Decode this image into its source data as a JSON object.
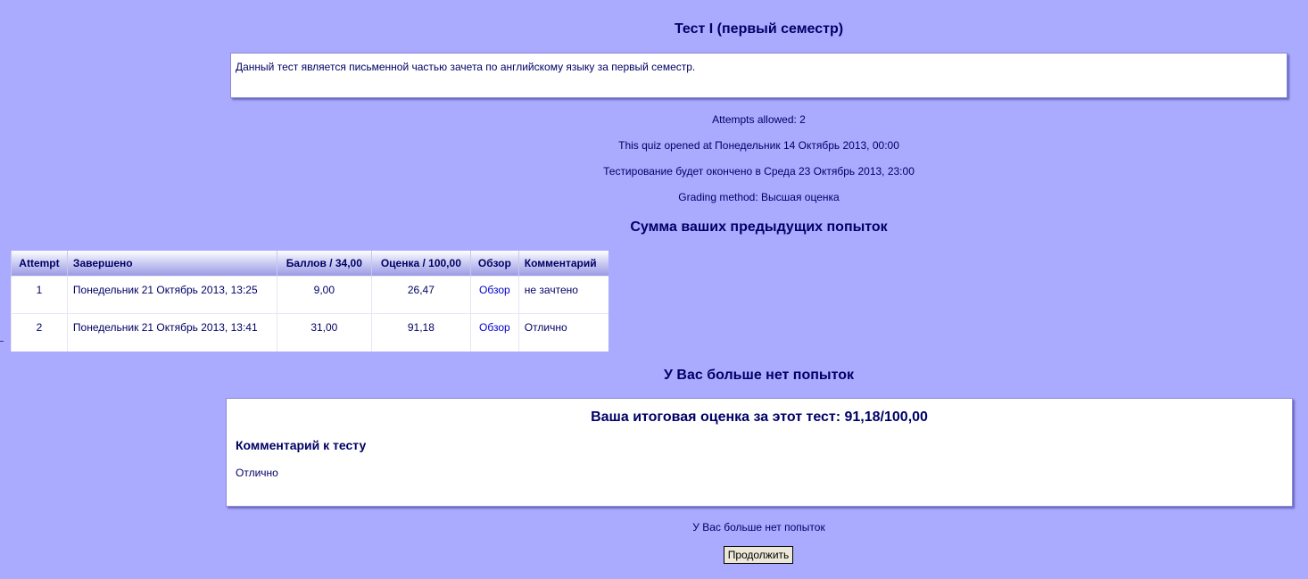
{
  "quiz": {
    "title": "Тест I (первый семестр)",
    "intro": "Данный тест является письменной частью зачета по английскому языку за первый семестр.",
    "attempts_allowed": "Attempts allowed: 2",
    "opened": "This quiz opened at Понедельник 14 Октябрь 2013, 00:00",
    "closes": "Тестирование будет окончено в Среда 23 Октябрь 2013, 23:00",
    "grading_method": "Grading method: Высшая оценка"
  },
  "summary": {
    "heading": "Сумма ваших предыдущих попыток",
    "columns": [
      "Attempt",
      "Завершено",
      "Баллов / 34,00",
      "Оценка / 100,00",
      "Обзор",
      "Комментарий"
    ],
    "rows": [
      {
        "attempt": "1",
        "completed": "Понедельник 21 Октябрь 2013, 13:25",
        "marks": "9,00",
        "grade": "26,47",
        "review": "Обзор",
        "feedback": "не зачтено"
      },
      {
        "attempt": "2",
        "completed": "Понедельник 21 Октябрь 2013, 13:41",
        "marks": "31,00",
        "grade": "91,18",
        "review": "Обзор",
        "feedback": "Отлично"
      }
    ]
  },
  "no_more_attempts_heading": "У Вас больше нет попыток",
  "result": {
    "final_grade": "Ваша итоговая оценка за этот тест: 91,18/100,00",
    "feedback_heading": "Комментарий к тесту",
    "feedback_text": "Отлично"
  },
  "footer": {
    "no_more_attempts": "У Вас больше нет попыток",
    "continue_label": "Продолжить"
  }
}
